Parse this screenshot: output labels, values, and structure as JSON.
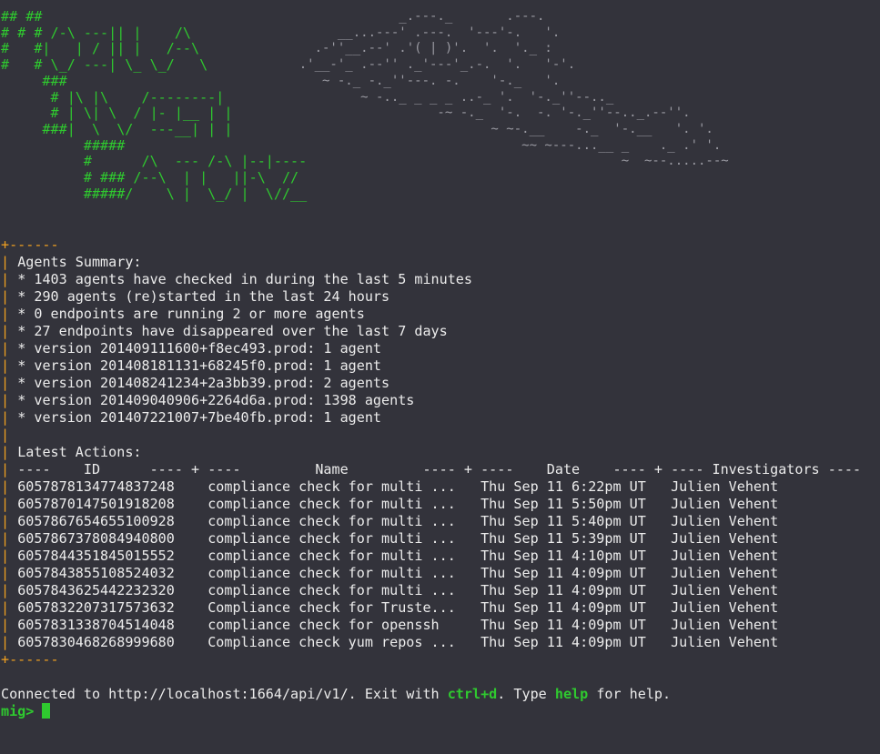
{
  "banner": {
    "logo_art": "## ##\n# # # /-\\ ---|| |    /\\\n#   #|   | / || |   /--\\\n#   # \\_/ ---| \\_ \\_/   \\\n     ###\n      # |\\ |\\    /--------|\n      # | \\| \\  / |- |__ | |\n     ###|  \\  \\/  ---__| | |\n          #####\n          #      /\\  --- /-\\ |--|----\n          # ### /--\\  | |   ||-\\  //\n          #####/    \\ |  \\_/ |  \\//__",
    "cloud_art": "                 _.---._       .---.\n         __...---' .---.  '---'-.   '.\n      .-''__.--' .'( | )'.  '.  '._ :\n    .'__-'_ .--'' ._'---'_.-.  '.   '-'.\n       ~ -._ -._''---. -.    '-._   '.\n            ~ -.._ _ _ _ ..-_ '.  '-._''--.._\n                      -~ -._  '-.  -. '-._''--.._.--''.\n                             ~ ~-.__    -._  '-.__   '. '.\n                                 ~~ ~---...__ _    ._ .' '.\n                                              ~  ~--.....--~"
  },
  "summary": {
    "border_top": "+------",
    "border_bottom": "+------",
    "heading": "Agents Summary:",
    "items": [
      "* 1403 agents have checked in during the last 5 minutes",
      "* 290 agents (re)started in the last 24 hours",
      "* 0 endpoints are running 2 or more agents",
      "* 27 endpoints have disappeared over the last 7 days",
      "* version 201409111600+f8ec493.prod: 1 agent",
      "* version 201408181131+68245f0.prod: 1 agent",
      "* version 201408241234+2a3bb39.prod: 2 agents",
      "* version 201409040906+2264d6a.prod: 1398 agents",
      "* version 201407221007+7be40fb.prod: 1 agent"
    ],
    "actions_heading": "Latest Actions:",
    "actions_header": "----    ID      ---- + ----         Name         ---- + ----    Date    ---- + ---- Investigators ----",
    "actions": [
      {
        "id": "6057878134774837248",
        "name": "compliance check for multi ...",
        "date": "Thu Sep 11 6:22pm UT",
        "investigator": "Julien Vehent"
      },
      {
        "id": "6057870147501918208",
        "name": "compliance check for multi ...",
        "date": "Thu Sep 11 5:50pm UT",
        "investigator": "Julien Vehent"
      },
      {
        "id": "6057867654655100928",
        "name": "compliance check for multi ...",
        "date": "Thu Sep 11 5:40pm UT",
        "investigator": "Julien Vehent"
      },
      {
        "id": "6057867378084940800",
        "name": "compliance check for multi ...",
        "date": "Thu Sep 11 5:39pm UT",
        "investigator": "Julien Vehent"
      },
      {
        "id": "6057844351845015552",
        "name": "compliance check for multi ...",
        "date": "Thu Sep 11 4:10pm UT",
        "investigator": "Julien Vehent"
      },
      {
        "id": "6057843855108524032",
        "name": "compliance check for multi ...",
        "date": "Thu Sep 11 4:09pm UT",
        "investigator": "Julien Vehent"
      },
      {
        "id": "6057843625442232320",
        "name": "compliance check for multi ...",
        "date": "Thu Sep 11 4:09pm UT",
        "investigator": "Julien Vehent"
      },
      {
        "id": "6057832207317573632",
        "name": "Compliance check for Truste...",
        "date": "Thu Sep 11 4:09pm UT",
        "investigator": "Julien Vehent"
      },
      {
        "id": "6057831338704514048",
        "name": "compliance check for openssh",
        "date": "Thu Sep 11 4:09pm UT",
        "investigator": "Julien Vehent"
      },
      {
        "id": "6057830468268999680",
        "name": "Compliance check yum repos ...",
        "date": "Thu Sep 11 4:09pm UT",
        "investigator": "Julien Vehent"
      }
    ]
  },
  "status": {
    "text_before": "Connected to http://localhost:1664/api/v1/. Exit with ",
    "key_exit": "ctrl+d",
    "text_middle": ". Type ",
    "key_help": "help",
    "text_after": " for help."
  },
  "prompt": {
    "label": "mig> "
  },
  "colors": {
    "background": "#33333b",
    "text": "#ececec",
    "accent_green": "#2fc92f",
    "border_orange": "#f0a020",
    "cloud_gray": "#9a9aa2"
  }
}
